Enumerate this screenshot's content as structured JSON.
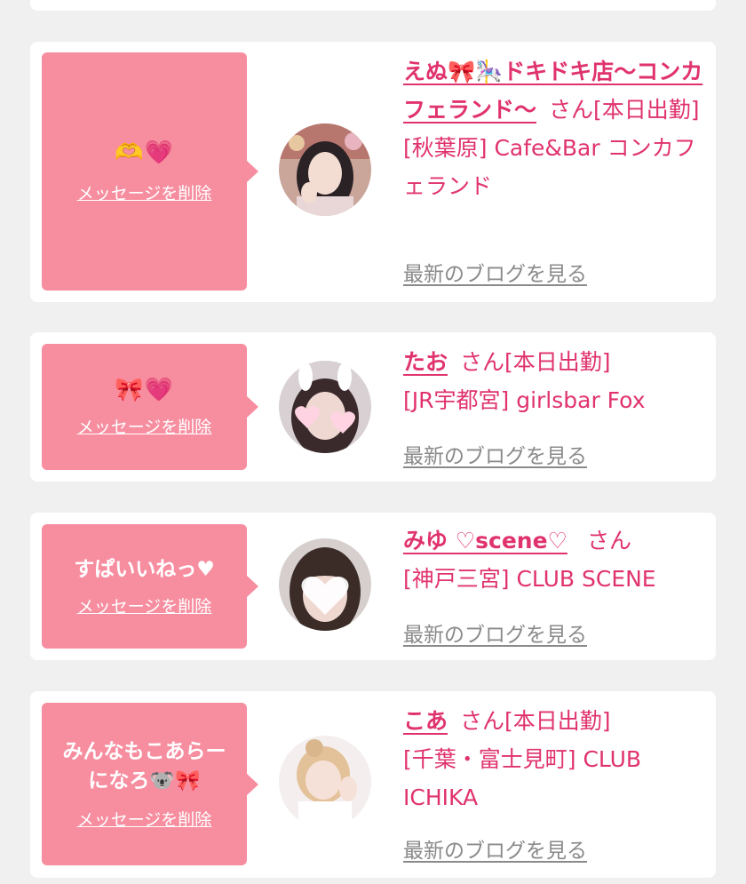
{
  "common": {
    "delete_label": "メッセージを削除",
    "blog_label": "最新のブログを見る",
    "honorific": "さん"
  },
  "messages": [
    {
      "bubble_text": "🫶💗",
      "cast_name": "えぬ🎀🎠ドキドキ店〜コンカフェランド〜",
      "status": "[本日出勤]",
      "shop": "[秋葉原] Cafe&Bar コンカフェランド"
    },
    {
      "bubble_text": "🎀💗",
      "cast_name": "たお",
      "status": "[本日出勤]",
      "shop": "[JR宇都宮] girlsbar Fox"
    },
    {
      "bubble_text": "すぱいいねっ♥",
      "cast_name": "みゆ ♡scene♡",
      "status": "",
      "shop": "[神戸三宮] CLUB SCENE"
    },
    {
      "bubble_text": "みんなもこあらーになろ🐨🎀",
      "cast_name": "こあ",
      "status": "[本日出勤]",
      "shop": "[千葉・富士見町] CLUB ICHIKA"
    }
  ],
  "colors": {
    "bubble": "#f78ea0",
    "accent": "#e0336e",
    "muted_link": "#8a8a8a",
    "background": "#f0f0f0"
  }
}
